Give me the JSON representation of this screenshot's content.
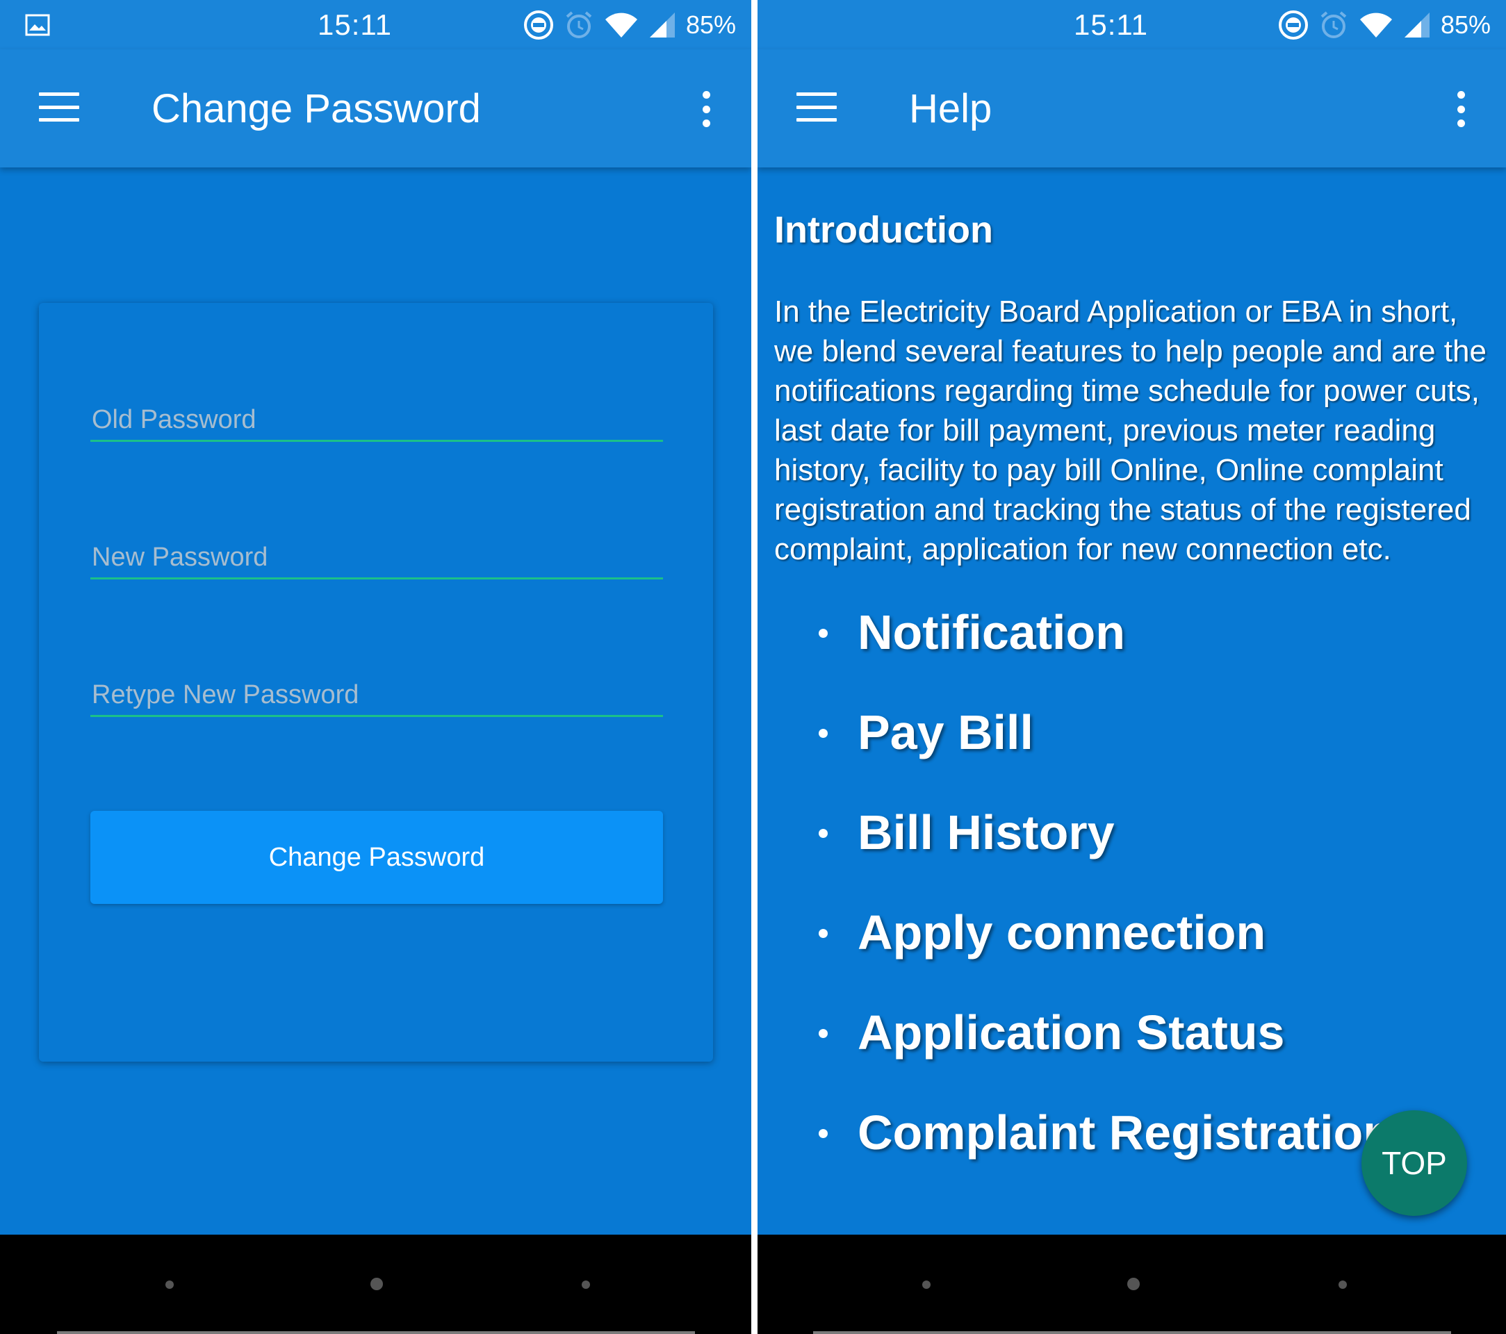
{
  "status_bar": {
    "time": "15:11",
    "battery": "85%",
    "icons": [
      "gallery-icon",
      "do-not-disturb-icon",
      "alarm-icon",
      "wifi-icon",
      "signal-icon"
    ]
  },
  "change_password_screen": {
    "title": "Change Password",
    "fields": {
      "old_password": "Old Password",
      "new_password": "New Password",
      "retype_password": "Retype New Password"
    },
    "submit_label": "Change Password"
  },
  "help_screen": {
    "title": "Help",
    "heading": "Introduction",
    "body": "In the Electricity Board Application or EBA in short, we blend several features to help people and are the notifications regarding time schedule for power cuts, last date for bill payment, previous meter reading history, facility to pay bill Online, Online complaint registration and tracking the status of the registered complaint, application for new connection etc.",
    "features": [
      "Notification",
      "Pay Bill",
      "Bill History",
      "Apply connection",
      "Application Status",
      "Complaint Registration"
    ],
    "top_button": "TOP"
  },
  "colors": {
    "primary": "#0879d3",
    "app_bar": "#1a85d9",
    "accent_underline": "#1bc089",
    "button": "#0b92f7",
    "fab": "#0c7a6a"
  }
}
